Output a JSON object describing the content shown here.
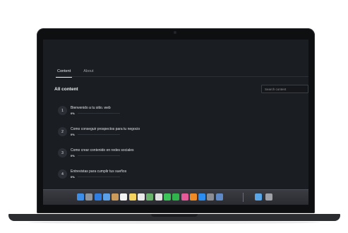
{
  "tabs": [
    {
      "label": "Content",
      "active": true
    },
    {
      "label": "About",
      "active": false
    }
  ],
  "heading": "All content",
  "search": {
    "placeholder": "Search content"
  },
  "items": [
    {
      "number": "1",
      "title": "Bienvenido a tu sitio. web",
      "progress_label": "0%",
      "progress": 0
    },
    {
      "number": "2",
      "title": "Como conseguir prospectos para tu negocio",
      "progress_label": "0%",
      "progress": 0
    },
    {
      "number": "3",
      "title": "Como crear contenido en redes sociales",
      "progress_label": "0%",
      "progress": 0
    },
    {
      "number": "4",
      "title": "Entrevistas para cumplir tus sueños",
      "progress_label": "0%",
      "progress": 0
    }
  ],
  "dock": {
    "apps": [
      {
        "icon": "finder-icon",
        "color": "#3d8ee8"
      },
      {
        "icon": "launchpad-icon",
        "color": "#8f939a"
      },
      {
        "icon": "safari-icon",
        "color": "#2f7de1"
      },
      {
        "icon": "photos-icon",
        "color": "#5aa0e8"
      },
      {
        "icon": "contacts-icon",
        "color": "#c99a5a"
      },
      {
        "icon": "calendar-icon",
        "color": "#f2f2f2"
      },
      {
        "icon": "notes-icon",
        "color": "#f4d35e"
      },
      {
        "icon": "reminders-icon",
        "color": "#e9e9e9"
      },
      {
        "icon": "maps-icon",
        "color": "#69b36b"
      },
      {
        "icon": "photo-library-icon",
        "color": "#e0e0e0"
      },
      {
        "icon": "messages-icon",
        "color": "#3bc559"
      },
      {
        "icon": "facetime-icon",
        "color": "#2fb34a"
      },
      {
        "icon": "itunes-icon",
        "color": "#e65a9a"
      },
      {
        "icon": "books-icon",
        "color": "#f08a24"
      },
      {
        "icon": "app-store-icon",
        "color": "#2b8df0"
      },
      {
        "icon": "system-preferences-icon",
        "color": "#8a8d93"
      },
      {
        "icon": "quicktime-icon",
        "color": "#5d89c7"
      }
    ],
    "right": [
      {
        "icon": "folder-icon",
        "color": "#58a6e8"
      },
      {
        "icon": "trash-icon",
        "color": "#9ea1a7"
      }
    ]
  }
}
